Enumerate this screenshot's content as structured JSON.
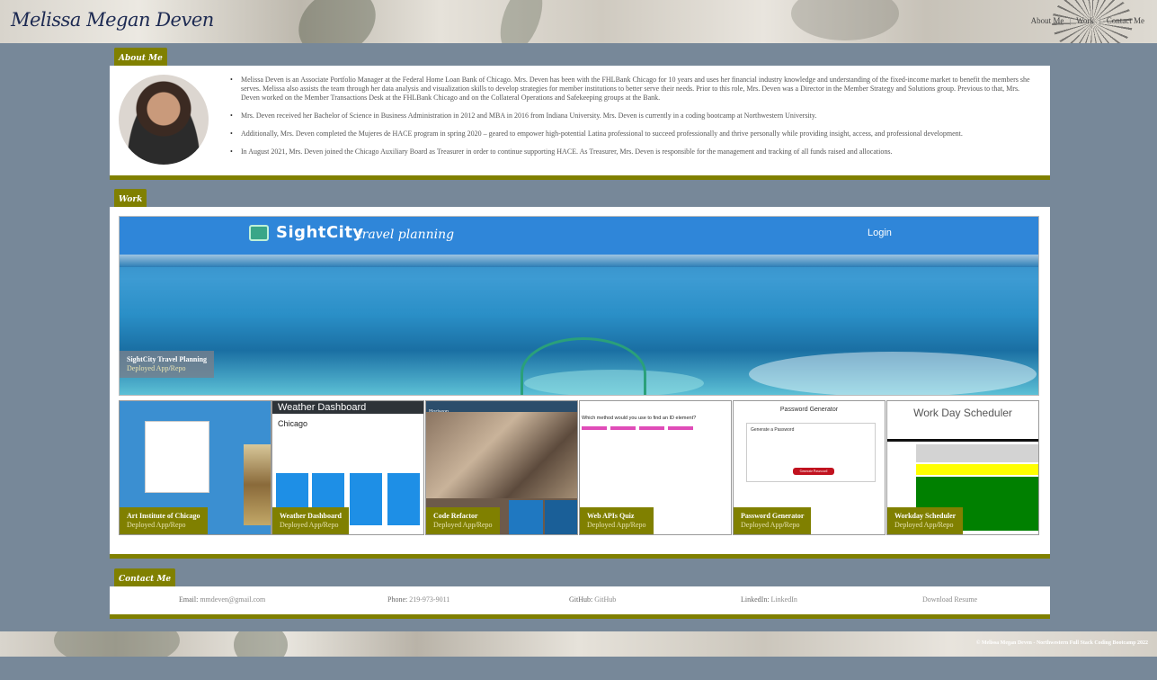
{
  "header": {
    "brand": "Melissa Megan Deven",
    "nav": [
      {
        "label": "About Me"
      },
      {
        "label": "Work"
      },
      {
        "label": "Contact Me"
      }
    ],
    "nav_separator": "|"
  },
  "about": {
    "tab_label": "About Me",
    "paragraphs": [
      "Melissa Deven is an Associate Portfolio Manager at the Federal Home Loan Bank of Chicago. Mrs. Deven has been with the FHLBank Chicago for 10 years and uses her financial industry knowledge and understanding of the fixed-income market to benefit the members she serves. Melissa also assists the team through her data analysis and visualization skills to develop strategies for member institutions to better serve their needs. Prior to this role, Mrs. Deven was a Director in the Member Strategy and Solutions group. Previous to that, Mrs. Deven worked on the Member Transactions Desk at the FHLBank Chicago and on the Collateral Operations and Safekeeping groups at the Bank.",
      "Mrs. Deven received her Bachelor of Science in Business Administration in 2012 and MBA in 2016 from Indiana University. Mrs. Deven is currently in a coding bootcamp at Northwestern University.",
      "Additionally, Mrs. Deven completed the Mujeres de HACE program in spring 2020 – geared to empower high-potential Latina professional to succeed professionally and thrive personally while providing insight, access, and professional development.",
      "In August 2021, Mrs. Deven joined the Chicago Auxiliary Board as Treasurer in order to continue supporting HACE. As Treasurer, Mrs. Deven is responsible for the management and tracking of all funds raised and allocations."
    ]
  },
  "work": {
    "tab_label": "Work",
    "featured": {
      "title": "SightCity Travel Planning",
      "deployed": "Deployed App",
      "repo": "Repo",
      "screenshot_logo": "SightCity",
      "screenshot_tagline": "travel planning",
      "screenshot_login": "Login"
    },
    "projects": [
      {
        "title": "Art Institute of Chicago",
        "deployed": "Deployed App",
        "repo": "Repo"
      },
      {
        "title": "Weather Dashboard",
        "deployed": "Deployed App",
        "repo": "Repo",
        "screenshot_header": "Weather Dashboard",
        "screenshot_city": "Chicago"
      },
      {
        "title": "Code Refactor",
        "deployed": "Deployed App",
        "repo": "Repo",
        "screenshot_brand": "Horiseon"
      },
      {
        "title": "Web APIs Quiz",
        "deployed": "Deployed App",
        "repo": "Repo",
        "screenshot_question": "Which method would you use to find an ID element?"
      },
      {
        "title": "Password Generator",
        "deployed": "Deployed App",
        "repo": "Repo",
        "screenshot_header": "Password Generator",
        "screenshot_subheader": "Generate a Password",
        "screenshot_button": "Generate Password"
      },
      {
        "title": "Workday Scheduler",
        "deployed": "Deployed App",
        "repo": "Repo",
        "screenshot_header": "Work Day Scheduler"
      }
    ],
    "link_separator": "/"
  },
  "contact": {
    "tab_label": "Contact Me",
    "email_label": "Email:",
    "email": "mmdeven@gmail.com",
    "phone_label": "Phone:",
    "phone": "219-973-9011",
    "github_label": "GitHub:",
    "github": "GitHub",
    "linkedin_label": "LinkedIn:",
    "linkedin": "LinkedIn",
    "resume": "Download Resume"
  },
  "footer": {
    "text": "© Melissa Megan Deven - Northwestern Full Stack Coding Bootcamp 2022"
  },
  "colors": {
    "page_bg": "#778899",
    "accent": "#808000",
    "brand_text": "#1d2a52"
  }
}
